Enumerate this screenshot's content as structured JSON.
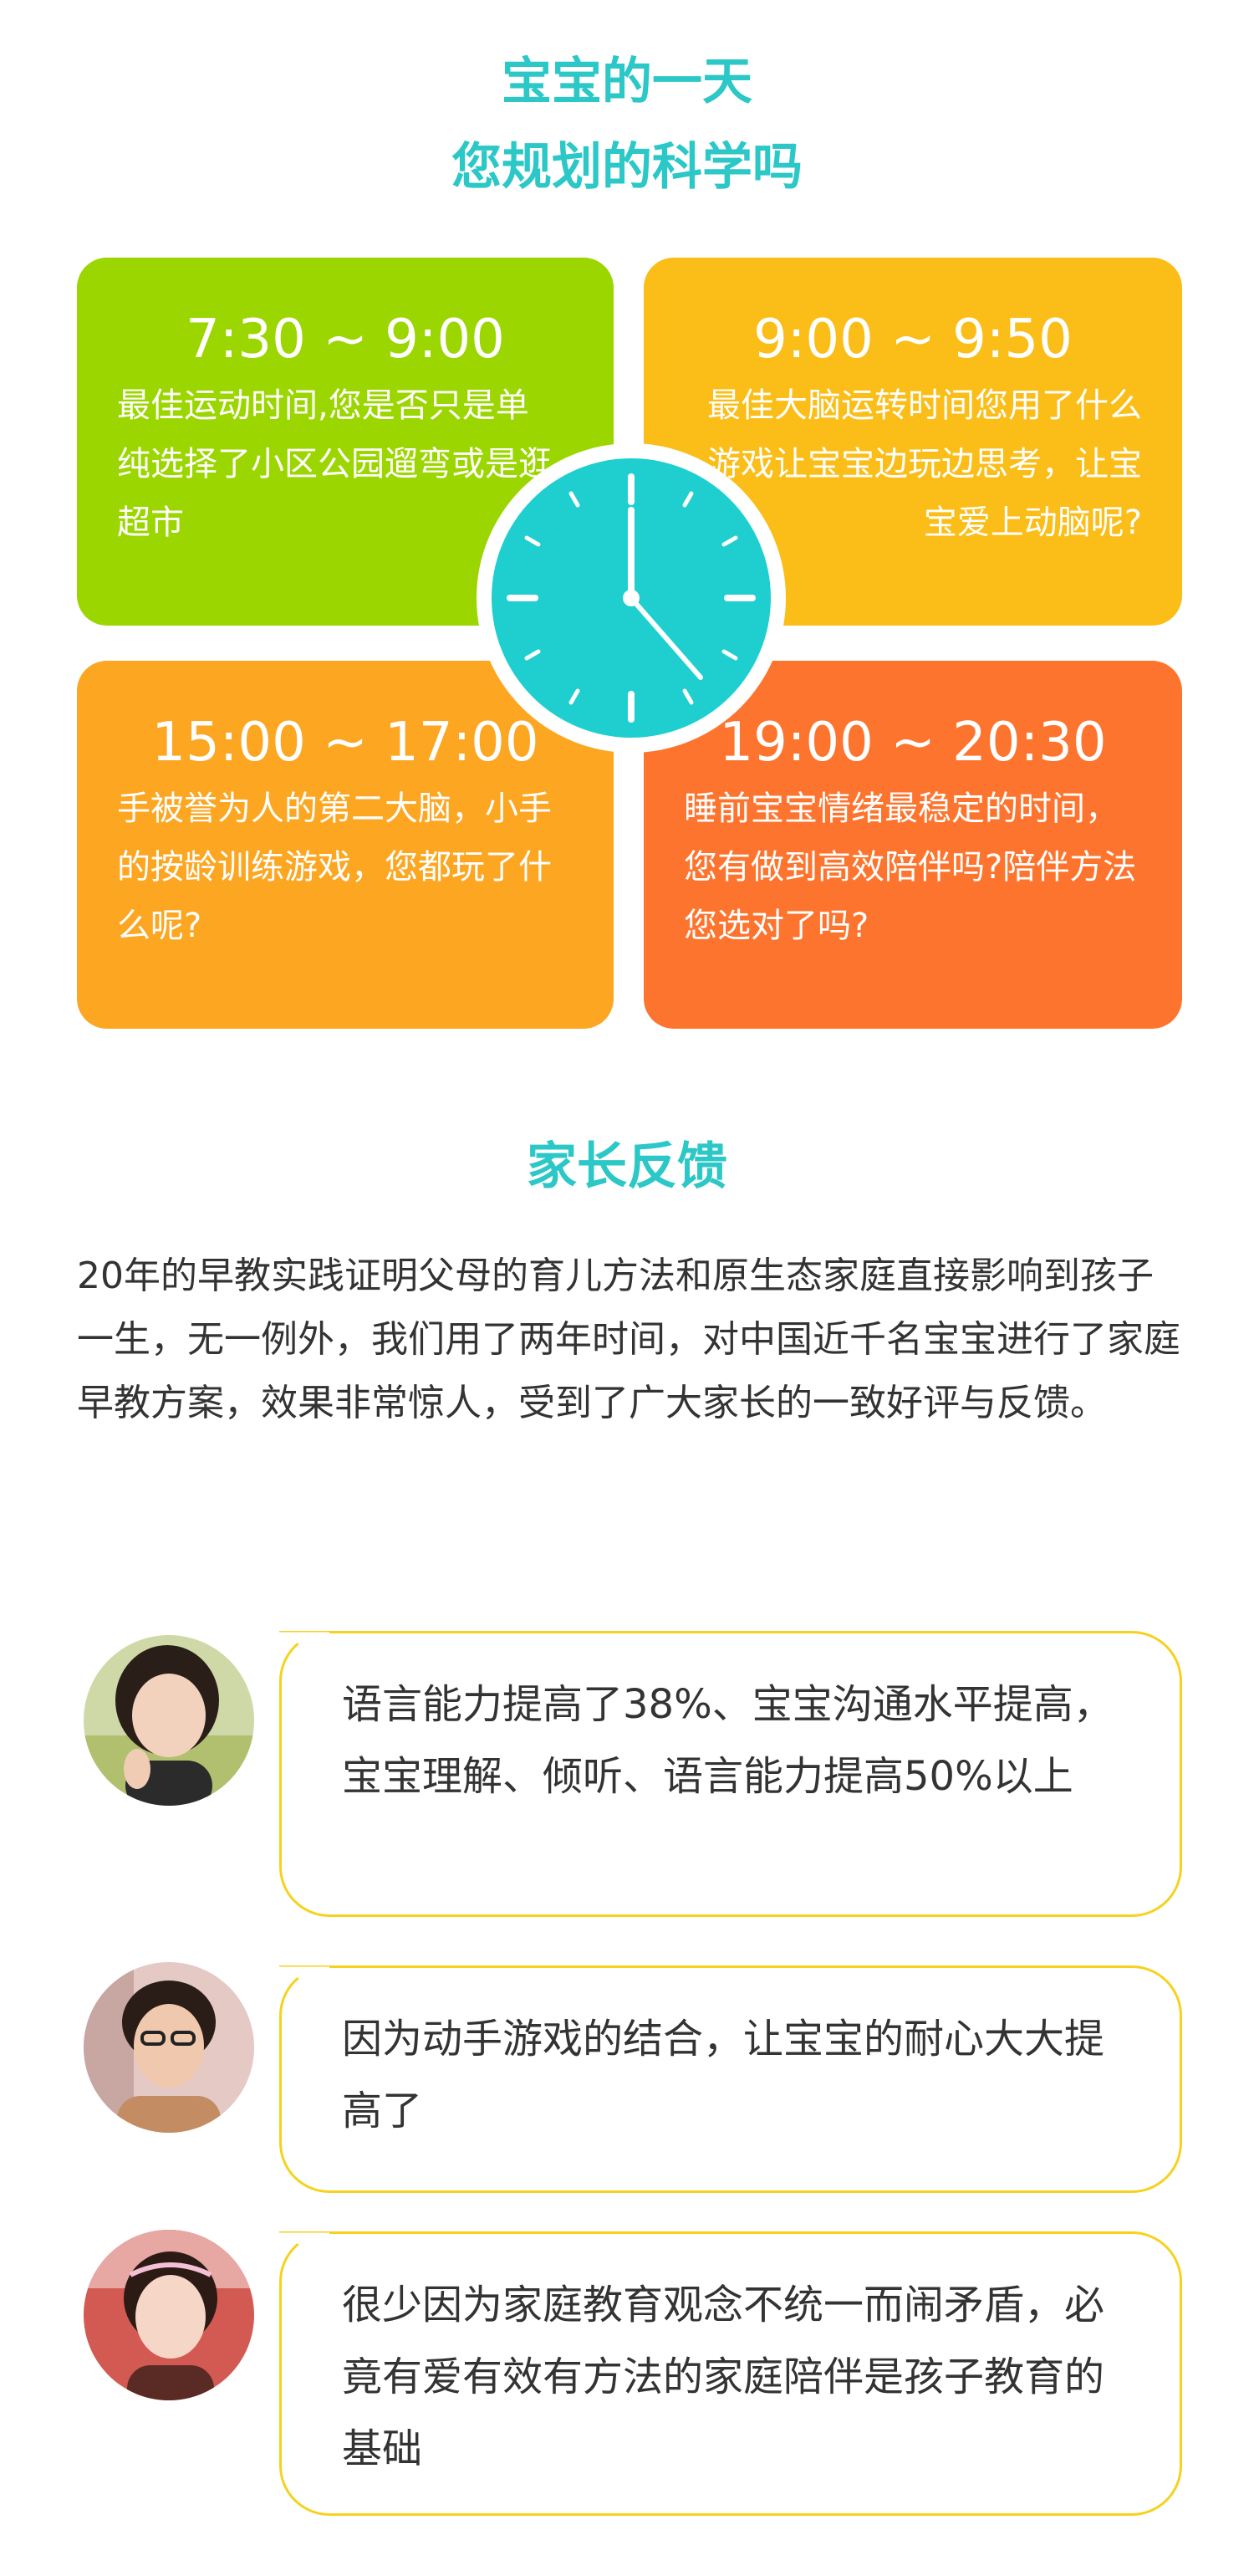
{
  "header": {
    "title_line1": "宝宝的一天",
    "title_line2": "您规划的科学吗"
  },
  "schedule": [
    {
      "time": "7:30 ~ 9:00",
      "text": "最佳运动时间,您是否只是单纯选择了小区公园遛弯或是逛超市",
      "color": "#9bd600"
    },
    {
      "time": "9:00 ~ 9:50",
      "text": "最佳大脑运转时间您用了什么游戏让宝宝边玩边思考，让宝宝爱上动脑呢?",
      "color": "#fbbd17"
    },
    {
      "time": "15:00 ~ 17:00",
      "text": "手被誉为人的第二大脑，小手的按龄训练游戏，您都玩了什么呢?",
      "color": "#fca621"
    },
    {
      "time": "19:00 ~ 20:30",
      "text": "睡前宝宝情绪最稳定的时间，您有做到高效陪伴吗?陪伴方法您选对了吗?",
      "color": "#fd742e"
    }
  ],
  "clock": {
    "icon": "clock-icon",
    "color": "#1fcfcf",
    "time_shown": "12:23"
  },
  "feedback": {
    "title": "家长反馈",
    "intro": "20年的早教实践证明父母的育儿方法和原生态家庭直接影响到孩子一生，无一例外，我们用了两年时间，对中国近千名宝宝进行了家庭早教方案，效果非常惊人，受到了广大家长的一致好评与反馈。",
    "items": [
      {
        "text": "语言能力提高了38%、宝宝沟通水平提高，宝宝理解、倾听、语言能力提高50%以上",
        "avatar": "parent-avatar"
      },
      {
        "text": "因为动手游戏的结合，让宝宝的耐心大大提高了",
        "avatar": "parent-avatar"
      },
      {
        "text": "很少因为家庭教育观念不统一而闹矛盾，必竟有爱有效有方法的家庭陪伴是孩子教育的基础",
        "avatar": "parent-avatar"
      }
    ]
  },
  "colors": {
    "accent": "#2cc7c7",
    "bubble_border": "#f6d21f",
    "text": "#333333"
  }
}
